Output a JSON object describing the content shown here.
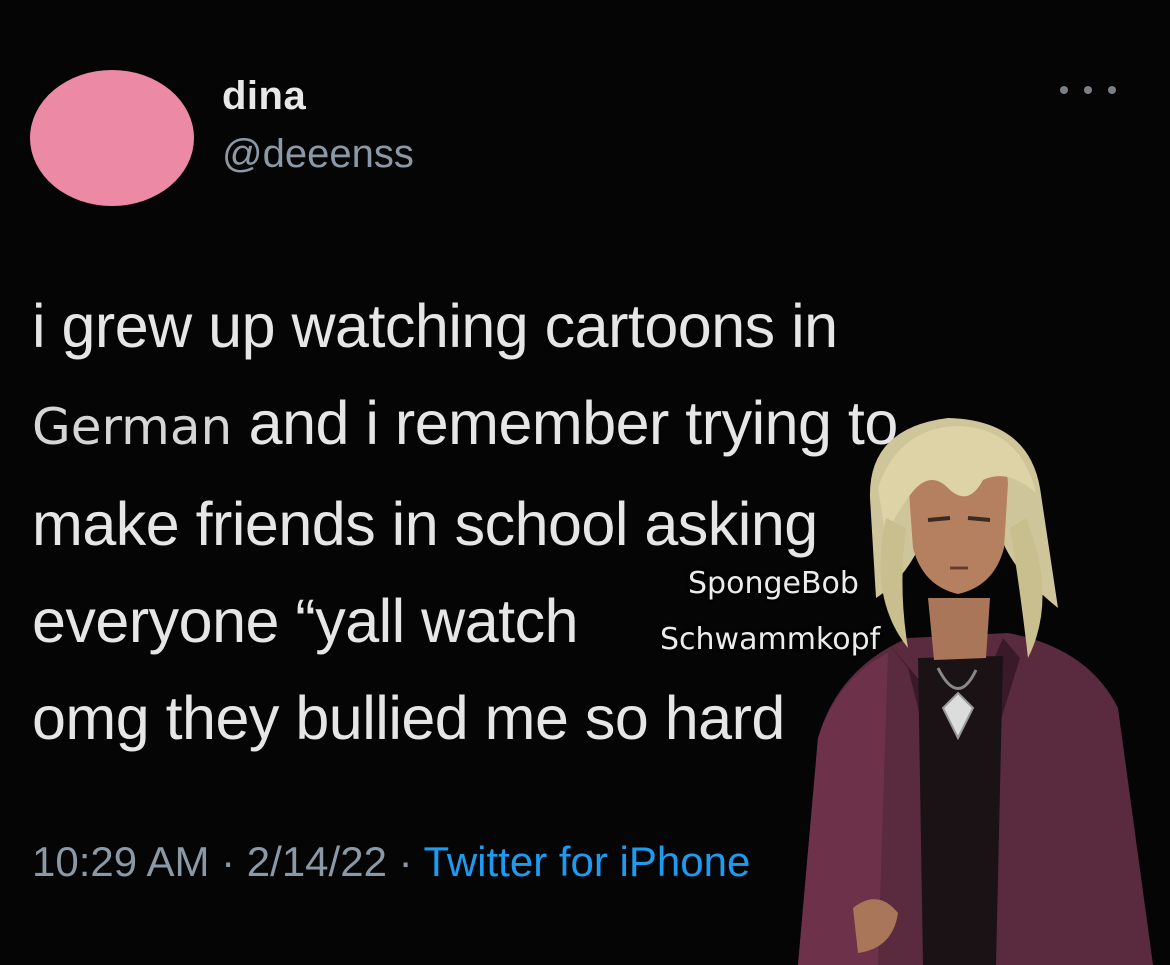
{
  "author": {
    "display_name": "dina",
    "handle": "@deeenss",
    "avatar_color": "#ec8aa6"
  },
  "menu": {
    "icon": "more-horizontal-icon"
  },
  "tweet": {
    "lines": [
      {
        "pre": "i grew up watching cartoons in"
      },
      {
        "overlay": "German",
        "post": " and i remember trying to"
      },
      {
        "pre": "make friends in school asking"
      },
      {
        "pre": "everyone “yall watch"
      },
      {
        "pre": "omg they bullied me so hard"
      }
    ]
  },
  "meta": {
    "time": "10:29 AM",
    "separator": " · ",
    "date": "2/14/22",
    "source": "Twitter for iPhone"
  },
  "overlay": {
    "caption_line1": "SpongeBob",
    "caption_line2": "Schwammkopf",
    "character": "anime-character-illustration"
  },
  "colors": {
    "background": "#050505",
    "text": "#e6e6e6",
    "muted": "#8b98a5",
    "link": "#1d9bf0"
  }
}
